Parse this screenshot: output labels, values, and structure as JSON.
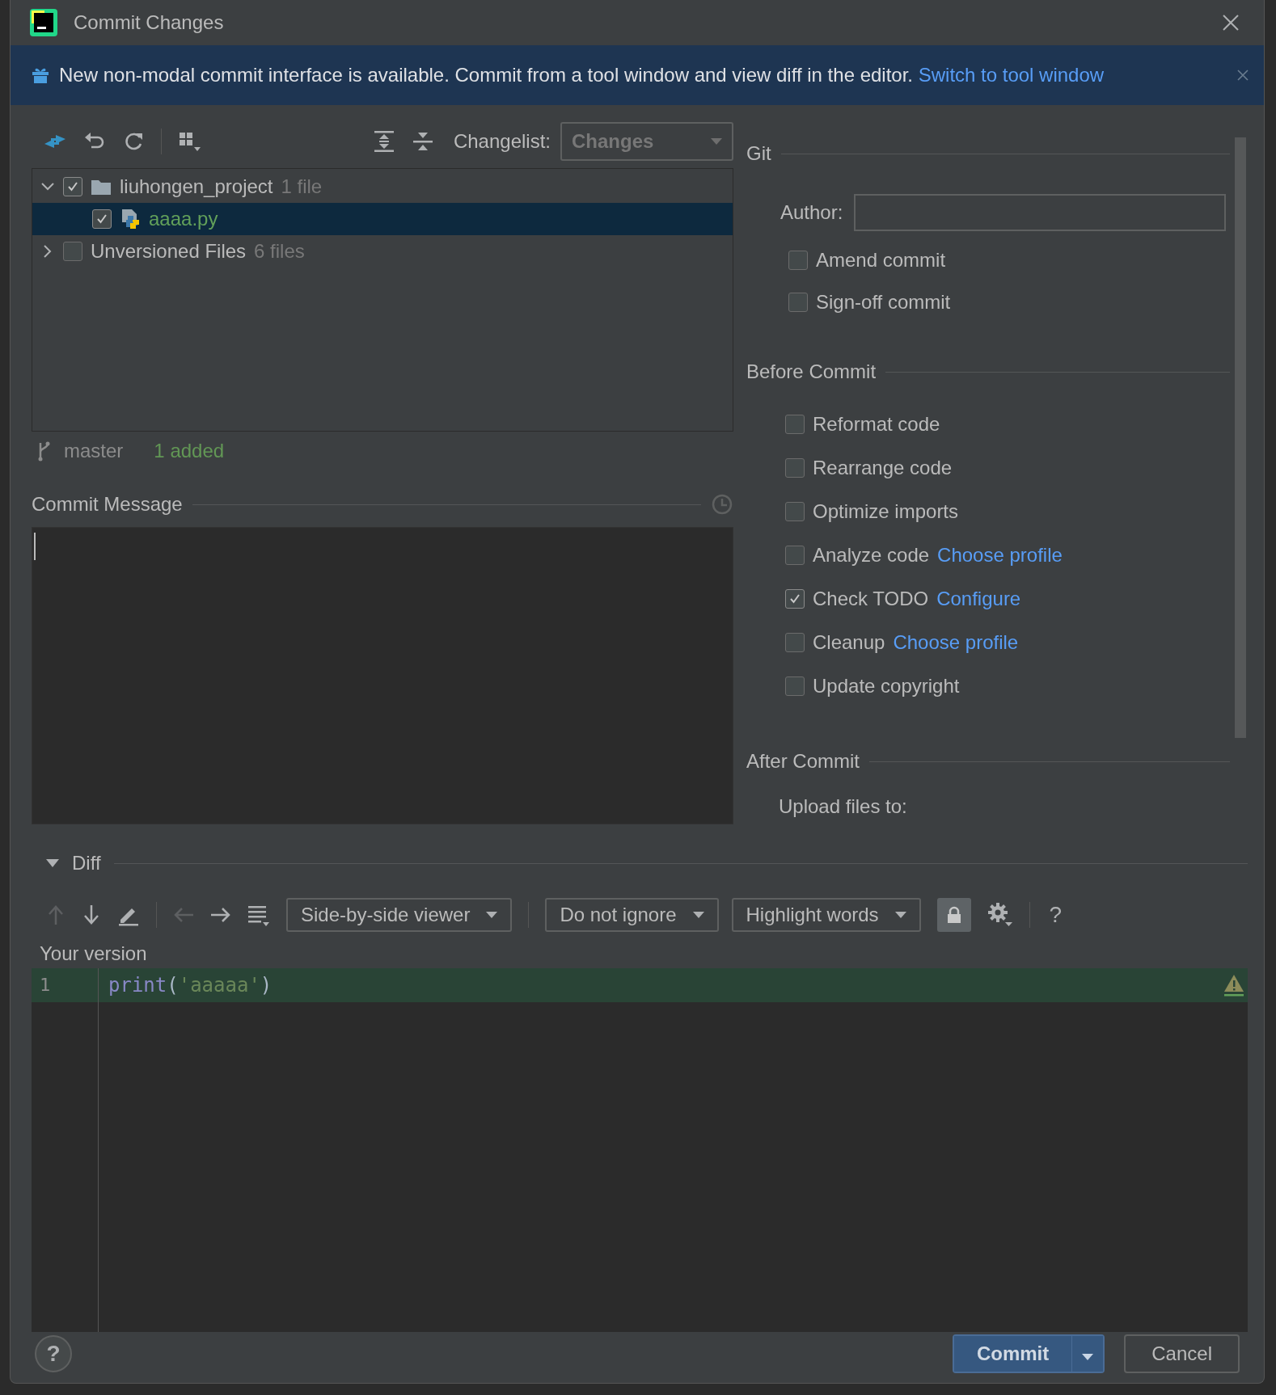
{
  "window": {
    "title": "Commit Changes"
  },
  "banner": {
    "text": "New non-modal commit interface is available. Commit from a tool window and view diff in the editor.",
    "link": "Switch to tool window"
  },
  "changes": {
    "changelist_label": "Changelist:",
    "changelist": "Changes",
    "tree": [
      {
        "label": "liuhongen_project",
        "count": "1 file",
        "kind": "folder",
        "checked": true,
        "expanded": true,
        "selected": false,
        "children": [
          {
            "label": "aaaa.py",
            "kind": "python",
            "checked": true,
            "selected": true
          }
        ]
      },
      {
        "label": "Unversioned Files",
        "count": "6 files",
        "kind": "group",
        "checked": false,
        "expanded": false,
        "selected": false
      }
    ],
    "branch": "master",
    "summary": "1 added"
  },
  "commit_message": {
    "title": "Commit Message"
  },
  "git": {
    "title": "Git",
    "author_label": "Author:",
    "options": [
      {
        "label": "Amend commit",
        "checked": false
      },
      {
        "label": "Sign-off commit",
        "checked": false
      }
    ]
  },
  "before_commit": {
    "title": "Before Commit",
    "options": [
      {
        "label": "Reformat code",
        "checked": false
      },
      {
        "label": "Rearrange code",
        "checked": false
      },
      {
        "label": "Optimize imports",
        "checked": false
      },
      {
        "label": "Analyze code",
        "link": "Choose profile",
        "checked": false
      },
      {
        "label": "Check TODO",
        "link": "Configure",
        "checked": true
      },
      {
        "label": "Cleanup",
        "link": "Choose profile",
        "checked": false
      },
      {
        "label": "Update copyright",
        "checked": false
      }
    ]
  },
  "after_commit": {
    "title": "After Commit",
    "upload_label": "Upload files to:"
  },
  "diff": {
    "title": "Diff",
    "expanded": true,
    "viewer": "Side-by-side viewer",
    "ignore": "Do not ignore",
    "highlight": "Highlight words",
    "help": "?",
    "side_label": "Your version",
    "lines": [
      {
        "number": "1",
        "tokens": [
          {
            "text": "print",
            "kind": "function"
          },
          {
            "text": "(",
            "kind": "plain"
          },
          {
            "text": "'aaaaa'",
            "kind": "string"
          },
          {
            "text": ")",
            "kind": "plain"
          }
        ]
      }
    ]
  },
  "footer": {
    "help": "?",
    "buttons": [
      {
        "label": "Commit",
        "kind": "primary"
      },
      {
        "label": "Cancel",
        "kind": "normal"
      }
    ]
  }
}
